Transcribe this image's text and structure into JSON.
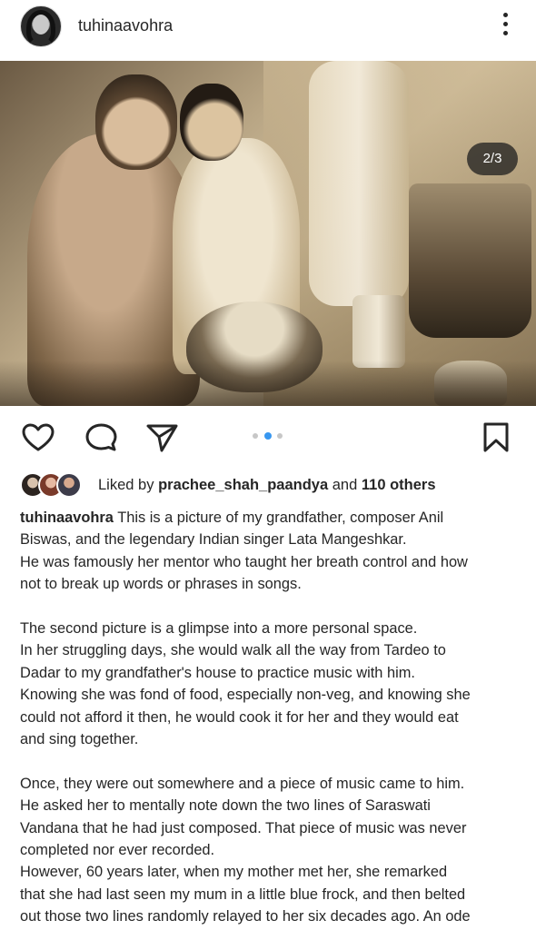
{
  "post": {
    "username": "tuhinaavohra",
    "carousel_position": "2/3",
    "carousel_total": 3,
    "carousel_active_index": 1
  },
  "icons": {
    "more": "more-vertical-icon",
    "like": "heart-icon",
    "comment": "comment-icon",
    "share": "send-icon",
    "save": "bookmark-icon"
  },
  "likes": {
    "prefix": "Liked by",
    "user": "prachee_shah_paandya",
    "joiner": "and",
    "others": "110 others"
  },
  "caption": {
    "username": "tuhinaavohra",
    "lines": [
      "This is a picture of my grandfather, composer Anil",
      "Biswas, and the legendary Indian singer Lata Mangeshkar.",
      "He was famously her mentor who taught her breath control and how",
      "not to break up words or phrases in songs.",
      "",
      "The second picture is a glimpse into a more personal space.",
      "In her struggling days, she would walk all the way from Tardeo to",
      "Dadar to my grandfather's house to practice music with him.",
      "Knowing she was fond of food, especially non-veg, and knowing she",
      "could not afford it then, he would cook it for her and they would eat",
      "and sing together.",
      "",
      "Once, they were out somewhere and a piece of music came to him.",
      "He asked her to mentally note down the two lines of Saraswati",
      "Vandana that he had just composed. That piece of music was never",
      "completed nor ever recorded.",
      "However, 60 years later, when my mother met her, she remarked",
      "that she had last seen my mum in a little blue frock, and then belted",
      "out those two lines randomly relayed to her six decades ago. An ode"
    ]
  },
  "colors": {
    "text": "#262626",
    "carousel_active": "#3897f0",
    "carousel_inactive": "#c7c7c7"
  }
}
